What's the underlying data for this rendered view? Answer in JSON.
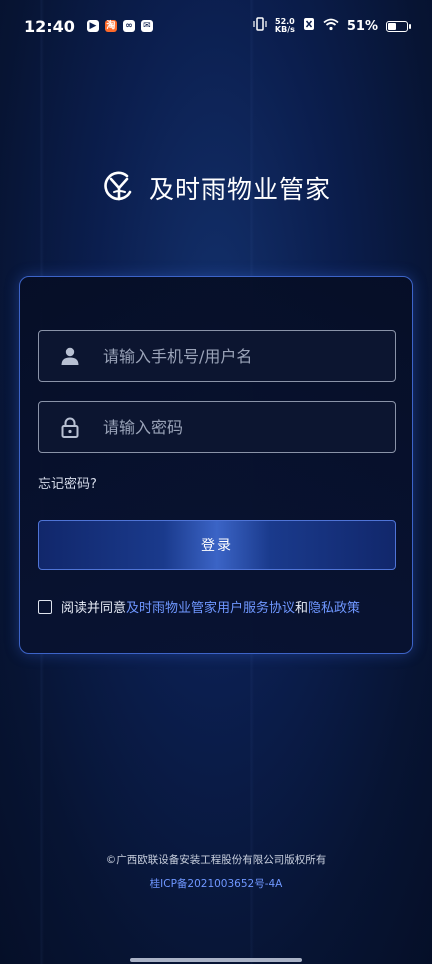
{
  "status_bar": {
    "time": "12:40",
    "net_speed_value": "52.0",
    "net_speed_unit": "KB/s",
    "battery_percent": "51%",
    "battery_level": 0.51
  },
  "brand": {
    "name": "及时雨物业管家"
  },
  "login": {
    "username_placeholder": "请输入手机号/用户名",
    "password_placeholder": "请输入密码",
    "forgot_password": "忘记密码?",
    "login_button": "登录",
    "agree_prefix": "阅读并同意",
    "agreement_link": "及时雨物业管家用户服务协议",
    "agree_and": "和",
    "privacy_link": "隐私政策"
  },
  "footer": {
    "copyright": "©广西欧联设备安装工程股份有限公司版权所有",
    "icp": "桂ICP备2021003652号-4A"
  },
  "colors": {
    "accent_link": "#6f97ff",
    "card_border": "#3d64c8",
    "background": "#0b1e4e"
  }
}
